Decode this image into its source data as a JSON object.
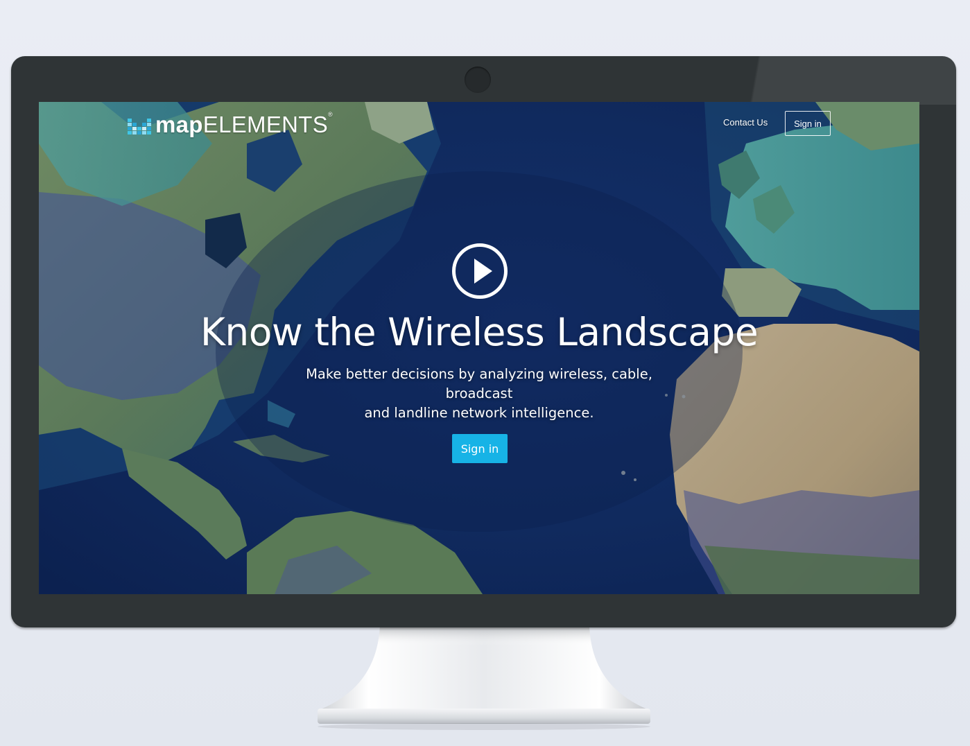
{
  "brand": {
    "name_bold": "map",
    "name_light": "ELEMENTS",
    "registered": "®",
    "logo_colors": [
      "#3fc6e8",
      "#8fdcf2",
      "#2aa7d6",
      "#c8eef8"
    ]
  },
  "nav": {
    "contact_label": "Contact Us",
    "signin_label": "Sign in"
  },
  "hero": {
    "title": "Know the Wireless Landscape",
    "subtitle_line1": "Make better decisions by analyzing wireless, cable, broadcast",
    "subtitle_line2": "and landline network intelligence.",
    "cta_label": "Sign in",
    "cta_color": "#17b3e6",
    "play_icon": "play-circle-icon"
  },
  "device": {
    "bezel_color": "#2f3436",
    "background_color": "#e8ebf2"
  }
}
